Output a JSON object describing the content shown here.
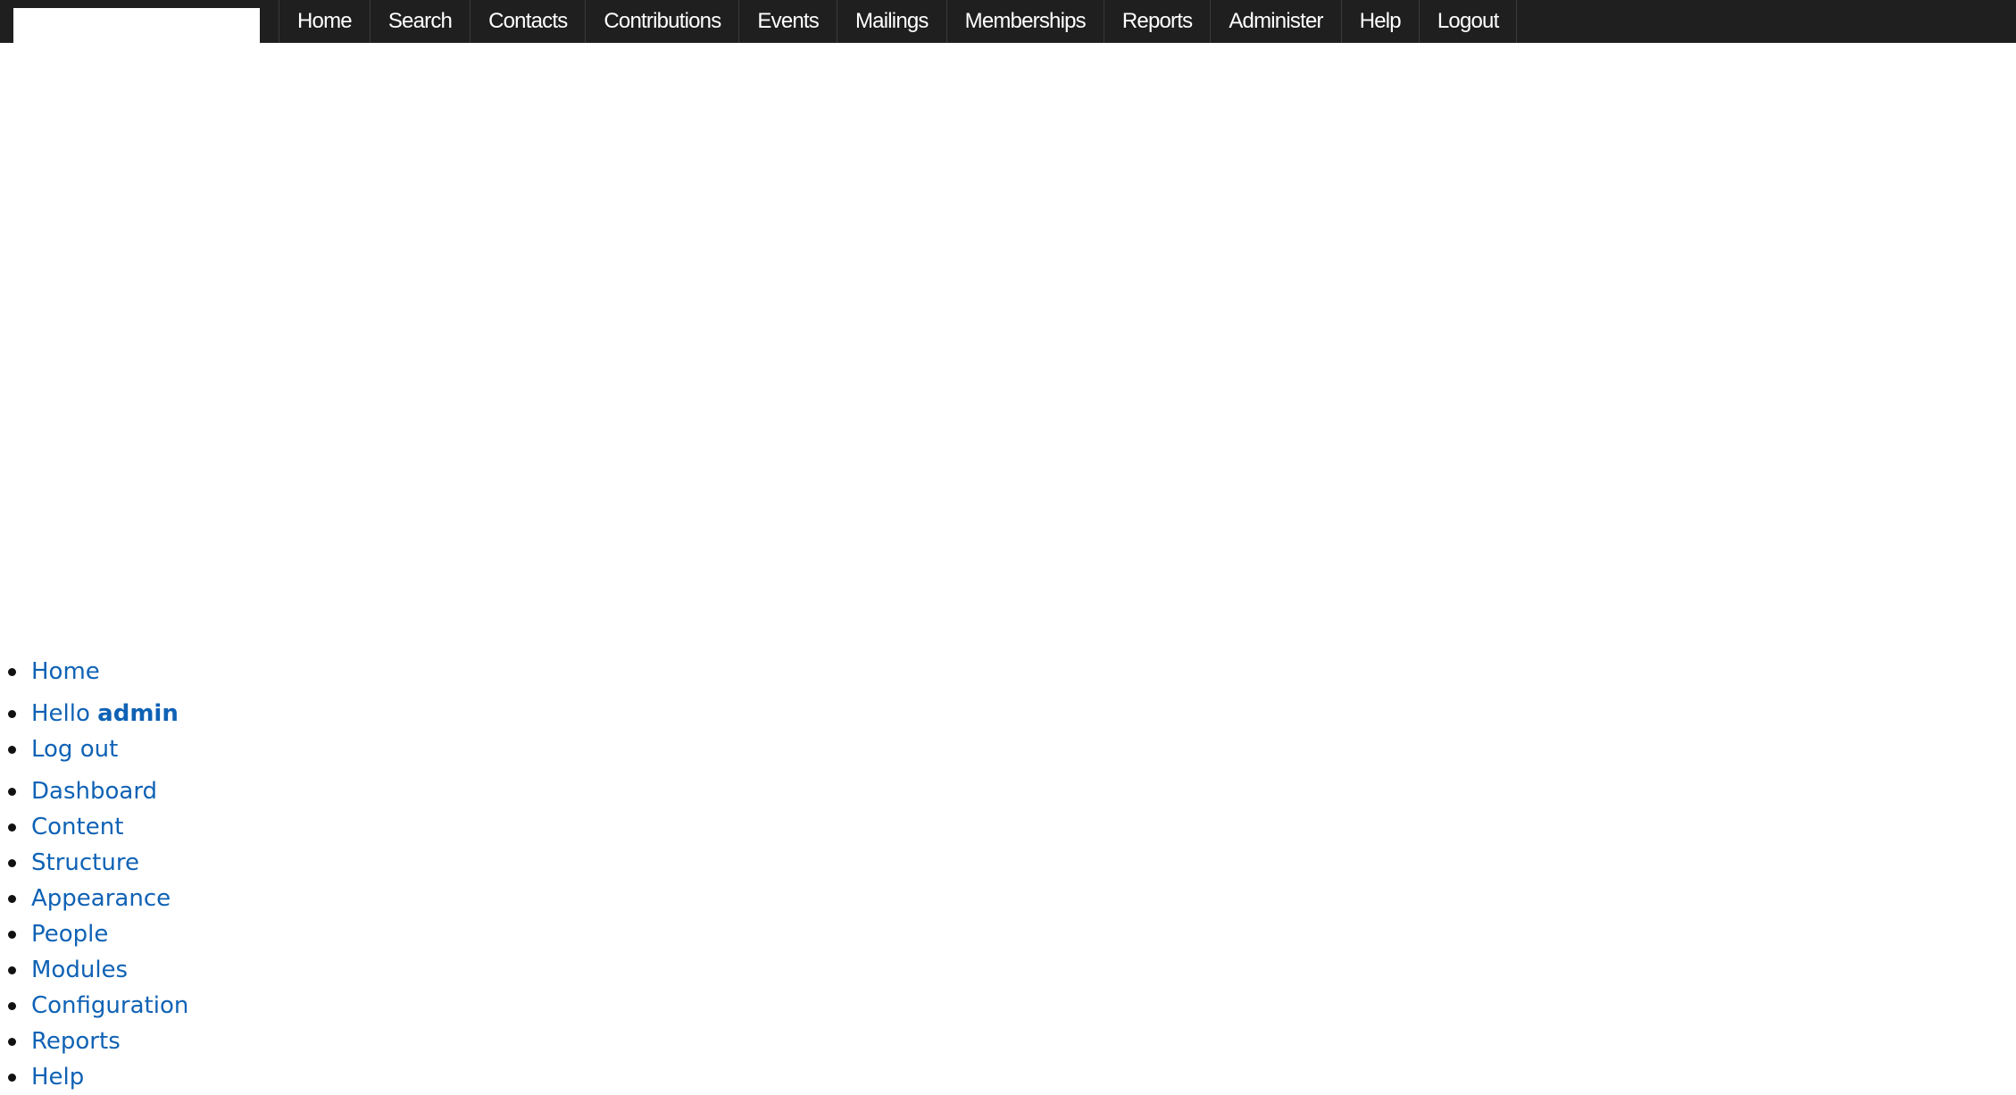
{
  "quicksearch": {
    "value": ""
  },
  "top_menu": [
    "Home",
    "Search",
    "Contacts",
    "Contributions",
    "Events",
    "Mailings",
    "Memberships",
    "Reports",
    "Administer",
    "Help",
    "Logout"
  ],
  "user_links": {
    "home": "Home",
    "hello_prefix": "Hello",
    "username": "admin",
    "logout": "Log out"
  },
  "admin_links": [
    "Dashboard",
    "Content",
    "Structure",
    "Appearance",
    "People",
    "Modules",
    "Configuration",
    "Reports",
    "Help"
  ],
  "colors": {
    "menu_bg": "#1f1f1f",
    "menu_text": "#ffffff",
    "link": "#0f62b5"
  }
}
